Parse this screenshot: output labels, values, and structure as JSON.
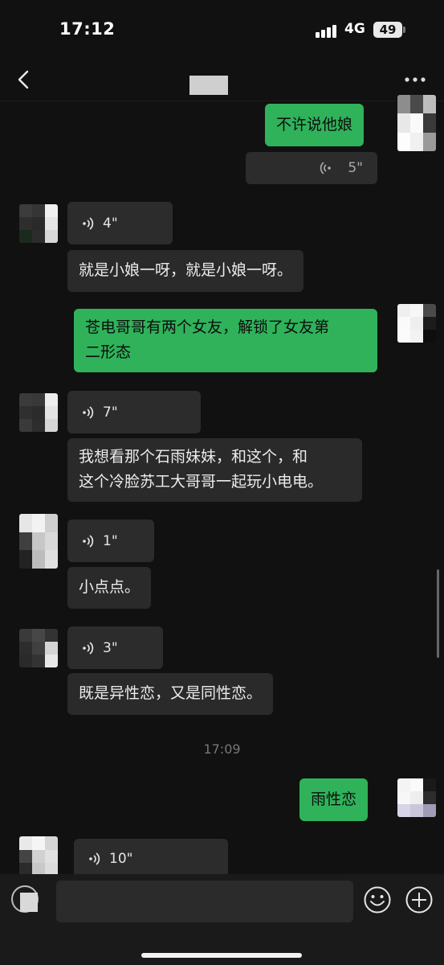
{
  "status_bar": {
    "time": "17:12",
    "network": "4G",
    "battery": "49"
  },
  "messages": {
    "m1": {
      "text": "不许说他娘"
    },
    "m2": {
      "duration": "5\""
    },
    "m3": {
      "duration": "4\""
    },
    "m4": {
      "text": "就是小娘一呀，就是小娘一呀。"
    },
    "m5": {
      "line1": "苍电哥哥有两个女友，解锁了女友第",
      "line2": "二形态"
    },
    "m6": {
      "duration": "7\""
    },
    "m7": {
      "line1": "我想看那个石雨妹妹，和这个，和",
      "line2": "这个冷脸苏工大哥哥一起玩小电电。"
    },
    "m8": {
      "duration": "1\""
    },
    "m9": {
      "text": "小点点。"
    },
    "m10": {
      "duration": "3\""
    },
    "m11": {
      "text": "既是异性恋，又是同性恋。"
    },
    "timestamp": "17:09",
    "m12": {
      "text": "雨性恋"
    },
    "m13": {
      "duration": "10\""
    }
  },
  "colors": {
    "sent_bubble": "#2fb25a",
    "received_bubble": "#2a2a2a",
    "background": "#111111"
  }
}
